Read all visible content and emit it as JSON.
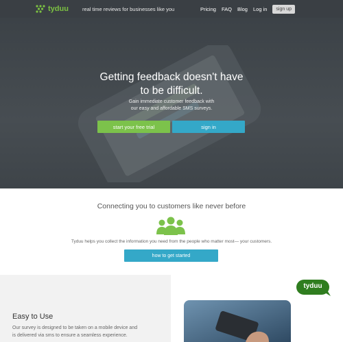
{
  "nav": {
    "logo_text": "tyduu",
    "tagline": "real time reviews for businesses like you",
    "links": [
      "Pricing",
      "FAQ",
      "Blog",
      "Log in"
    ],
    "signup_label": "sign up"
  },
  "hero": {
    "title_line1": "Getting feedback doesn't have",
    "title_line2": "to be difficult.",
    "sub_line1": "Gain immediate customer feedback with",
    "sub_line2": "our easy and affordable SMS surveys.",
    "trial_label": "start your free trial",
    "signin_label": "sign in"
  },
  "connect": {
    "title": "Connecting you to customers like never before",
    "text": "Tyduu helps you collect the information you need from the people who matter most— your customers.",
    "button_label": "how to get started"
  },
  "easy": {
    "title": "Easy to Use",
    "line1": "Our survey is designed to be taken on a mobile device and",
    "line2": "is delivered via sms to ensure a seamless experience."
  },
  "chat": {
    "text": "tyduu"
  },
  "colors": {
    "brand_green": "#7cc242",
    "button_blue": "#34a8c8",
    "nav_bg": "#3a3f44"
  },
  "icons": [
    "tyduu-logo-icon",
    "people-group-icon",
    "chat-bubble-icon"
  ]
}
